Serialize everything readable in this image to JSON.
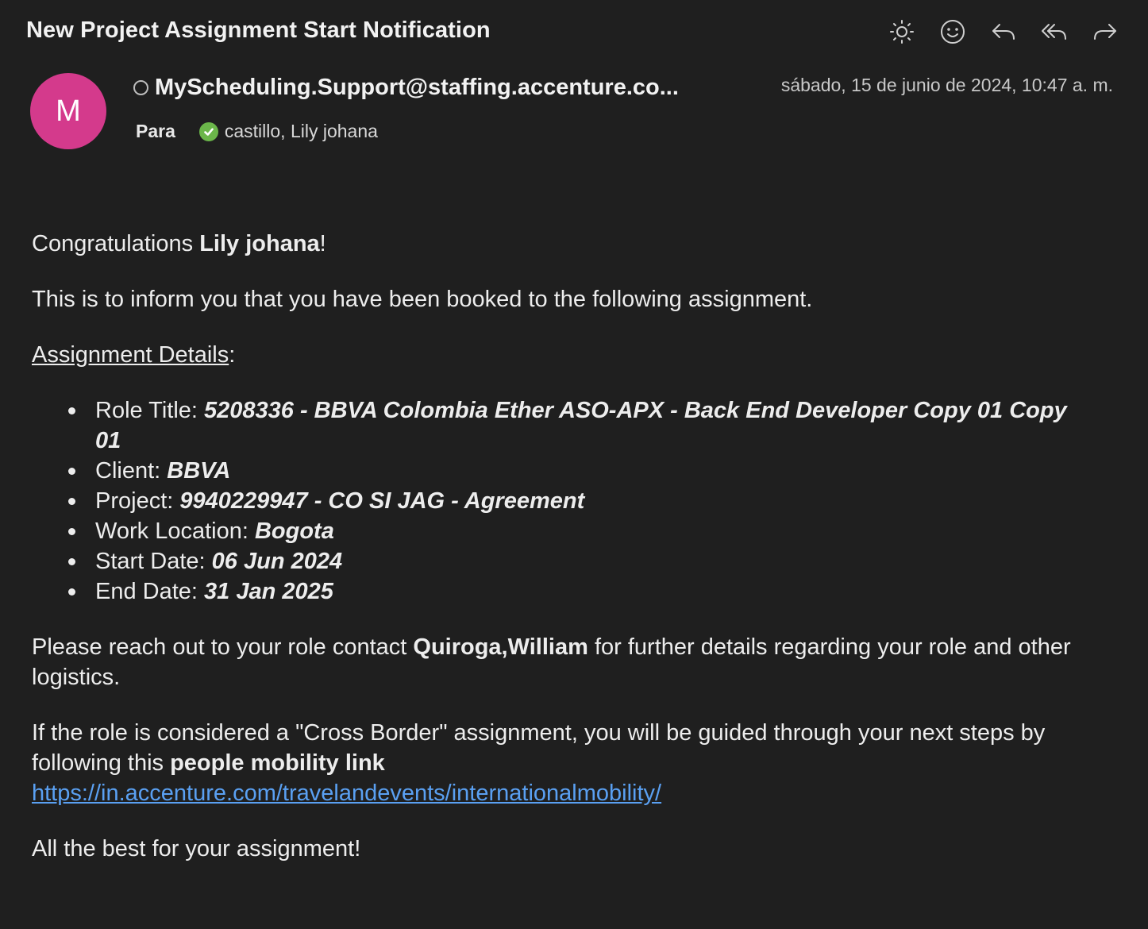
{
  "email": {
    "subject": "New Project Assignment Start Notification",
    "sender": {
      "avatar_initial": "M",
      "avatar_color": "#d43a8c",
      "address": "MyScheduling.Support@staffing.accenture.co..."
    },
    "date": "sábado, 15 de junio de 2024, 10:47 a. m.",
    "to_label": "Para",
    "recipient": "castillo, Lily johana"
  },
  "toolbar": {
    "icons": [
      "sun-icon",
      "emoji-icon",
      "reply-icon",
      "reply-all-icon",
      "forward-icon"
    ]
  },
  "body": {
    "greeting_prefix": "Congratulations ",
    "greeting_name": "Lily johana",
    "greeting_suffix": "!",
    "intro": "This is to inform you that you have been booked to the following assignment.",
    "details_heading": "Assignment Details",
    "details_colon": ":",
    "details": [
      {
        "label": "Role Title: ",
        "value": "5208336 - BBVA Colombia Ether ASO-APX - Back End Developer Copy 01 Copy 01"
      },
      {
        "label": "Client: ",
        "value": "BBVA"
      },
      {
        "label": "Project: ",
        "value": "9940229947 - CO SI JAG - Agreement"
      },
      {
        "label": "Work Location: ",
        "value": "Bogota"
      },
      {
        "label": "Start Date: ",
        "value": "06 Jun 2024"
      },
      {
        "label": "End Date: ",
        "value": "31 Jan 2025"
      }
    ],
    "contact_prefix": "Please reach out to your role contact ",
    "contact_name": "Quiroga,William",
    "contact_suffix": " for further details regarding your role and other logistics.",
    "cross_border_prefix": "If the role is considered a \"Cross Border\" assignment, you will be guided through your next steps by following this ",
    "cross_border_bold": "people mobility link",
    "link_url": "https://in.accenture.com/travelandevents/internationalmobility/",
    "closing": "All the best for your assignment!"
  },
  "colors": {
    "background": "#1f1f1f",
    "link": "#5aa0f2",
    "presence_check": "#6bb64a"
  }
}
